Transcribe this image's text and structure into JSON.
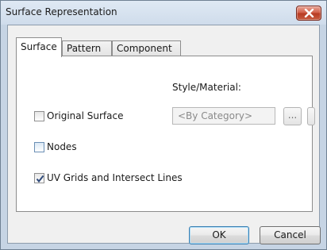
{
  "window": {
    "title": "Surface Representation"
  },
  "tabs": [
    {
      "label": "Surface",
      "active": true
    },
    {
      "label": "Pattern",
      "active": false
    },
    {
      "label": "Component",
      "active": false
    }
  ],
  "panel": {
    "style_label": "Style/Material:",
    "checkboxes": [
      {
        "label": "Original Surface",
        "checked": false
      },
      {
        "label": "Nodes",
        "checked": false
      },
      {
        "label": "UV Grids and Intersect Lines",
        "checked": true
      }
    ],
    "material_value": "<By Category>",
    "browse_label": "..."
  },
  "buttons": {
    "ok": "OK",
    "cancel": "Cancel"
  },
  "colors": {
    "close_button": "#c75b3f",
    "ok_focus": "#3c7fb1",
    "checkmark": "#2f4a7a"
  }
}
